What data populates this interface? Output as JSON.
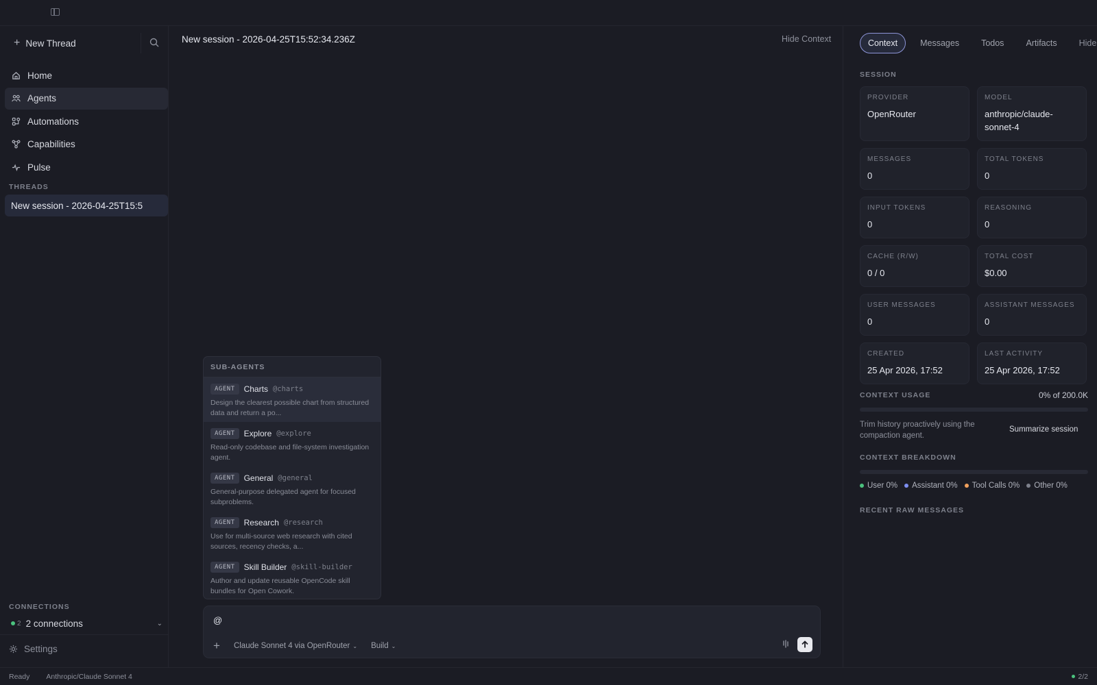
{
  "sidebar": {
    "new_thread_label": "New Thread",
    "nav": [
      {
        "label": "Home",
        "icon": "home-icon"
      },
      {
        "label": "Agents",
        "icon": "agents-icon"
      },
      {
        "label": "Automations",
        "icon": "automations-icon"
      },
      {
        "label": "Capabilities",
        "icon": "capabilities-icon"
      },
      {
        "label": "Pulse",
        "icon": "pulse-icon"
      }
    ],
    "threads_label": "THREADS",
    "thread_item": "New session - 2026-04-25T15:5",
    "connections_label": "CONNECTIONS",
    "connections_count": "2",
    "connections_text": "2 connections",
    "settings_label": "Settings"
  },
  "main": {
    "title": "New session - 2026-04-25T15:52:34.236Z",
    "hide_context": "Hide Context"
  },
  "popup": {
    "header": "SUB-AGENTS",
    "badge": "AGENT",
    "agents": [
      {
        "name": "Charts",
        "handle": "@charts",
        "desc": "Design the clearest possible chart from structured data and return a po..."
      },
      {
        "name": "Explore",
        "handle": "@explore",
        "desc": "Read-only codebase and file-system investigation agent."
      },
      {
        "name": "General",
        "handle": "@general",
        "desc": "General-purpose delegated agent for focused subproblems."
      },
      {
        "name": "Research",
        "handle": "@research",
        "desc": "Use for multi-source web research with cited sources, recency checks, a..."
      },
      {
        "name": "Skill Builder",
        "handle": "@skill-builder",
        "desc": "Author and update reusable OpenCode skill bundles for Open Cowork."
      }
    ]
  },
  "composer": {
    "value": "@",
    "model_label": "Claude Sonnet 4 via OpenRouter",
    "mode_label": "Build"
  },
  "status": {
    "ready": "Ready",
    "model": "Anthropic/Claude Sonnet 4",
    "connections": "2/2"
  },
  "right": {
    "tabs": [
      "Context",
      "Messages",
      "Todos",
      "Artifacts",
      "Hide"
    ],
    "session_label": "SESSION",
    "cards": [
      {
        "k": "PROVIDER",
        "v": "OpenRouter"
      },
      {
        "k": "MODEL",
        "v": "anthropic/claude-sonnet-4"
      },
      {
        "k": "MESSAGES",
        "v": "0"
      },
      {
        "k": "TOTAL TOKENS",
        "v": "0"
      },
      {
        "k": "INPUT TOKENS",
        "v": "0"
      },
      {
        "k": "REASONING",
        "v": "0"
      },
      {
        "k": "CACHE (R/W)",
        "v": "0 / 0"
      },
      {
        "k": "TOTAL COST",
        "v": "$0.00"
      },
      {
        "k": "USER MESSAGES",
        "v": "0"
      },
      {
        "k": "ASSISTANT MESSAGES",
        "v": "0"
      },
      {
        "k": "CREATED",
        "v": "25 Apr 2026, 17:52"
      },
      {
        "k": "LAST ACTIVITY",
        "v": "25 Apr 2026, 17:52"
      }
    ],
    "context_usage_label": "CONTEXT USAGE",
    "context_usage_value": "0% of 200.0K",
    "context_usage_fraction": 0,
    "trim_text": "Trim history proactively using the compaction agent.",
    "summarize_label": "Summarize session",
    "breakdown_label": "CONTEXT BREAKDOWN",
    "legend": [
      {
        "label": "User 0%",
        "color": "#4bc27e"
      },
      {
        "label": "Assistant 0%",
        "color": "#7d8ef0"
      },
      {
        "label": "Tool Calls 0%",
        "color": "#f0a05c"
      },
      {
        "label": "Other 0%",
        "color": "#7d808b"
      }
    ],
    "recent_label": "RECENT RAW MESSAGES"
  },
  "colors": {
    "background": "#1b1c24",
    "accent": "#8d95d8",
    "active_nav": "#272934",
    "status_green": "#4bc27e"
  }
}
